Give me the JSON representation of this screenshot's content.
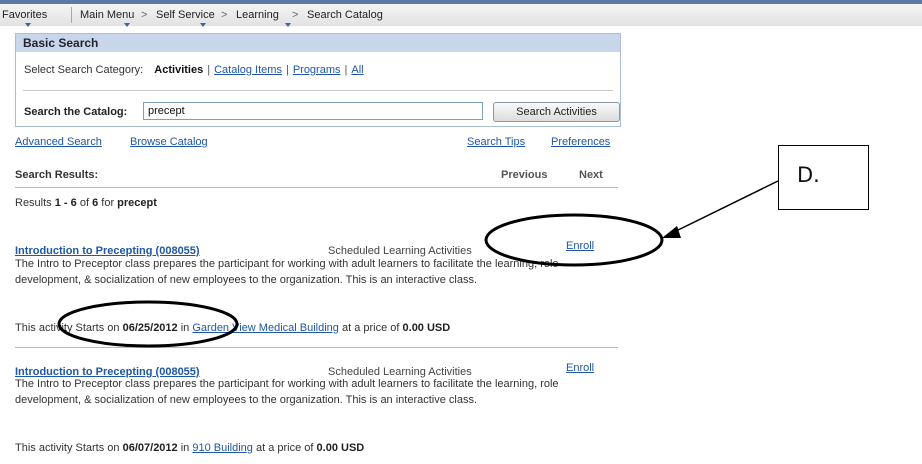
{
  "menu": {
    "favorites": "Favorites",
    "main_menu": "Main Menu",
    "self_service": "Self Service",
    "learning": "Learning",
    "search_catalog": "Search Catalog",
    "separator": ">"
  },
  "basic_search": {
    "title": "Basic Search",
    "category_label": "Select Search Category:",
    "categories": [
      "Activities",
      "Catalog Items",
      "Programs",
      "All"
    ],
    "active_category": "Activities",
    "search_label": "Search the Catalog:",
    "search_value": "precept",
    "search_button": "Search Activities"
  },
  "links": {
    "advanced_search": "Advanced Search",
    "browse_catalog": "Browse Catalog",
    "search_tips": "Search Tips",
    "preferences": "Preferences"
  },
  "results": {
    "header": "Search Results:",
    "previous": "Previous",
    "next": "Next",
    "summary_prefix": "Results",
    "range": "1 - 6",
    "of": "of",
    "total": "6",
    "for": "for",
    "query": "precept",
    "items": [
      {
        "title": "Introduction to Precepting (008055)",
        "type": "Scheduled Learning Activities",
        "enroll": "Enroll",
        "description": "The Intro to Preceptor class prepares the participant for working with adult learners to facilitate the learning, role development, & socialization of new employees to the organization. This is an interactive class.",
        "start_prefix": "This activity Starts on",
        "start_date": "06/25/2012",
        "in": "in",
        "location": "Garden View Medical Building",
        "price_prefix": "at a price of",
        "price": "0.00 USD"
      },
      {
        "title": "Introduction to Precepting (008055)",
        "type": "Scheduled Learning Activities",
        "enroll": "Enroll",
        "description": "The Intro to Preceptor class prepares the participant for working with adult learners to facilitate the learning, role development, & socialization of new employees to the organization. This is an interactive class.",
        "start_prefix": "This activity Starts on",
        "start_date": "06/07/2012",
        "in": "in",
        "location": "910 Building",
        "price_prefix": "at a price of",
        "price": "0.00 USD"
      }
    ]
  },
  "annotation": {
    "label": "D."
  },
  "colors": {
    "link": "#1f57a4",
    "panel_header": "#c7d6ea",
    "menu_accent": "#5a7aa6"
  }
}
